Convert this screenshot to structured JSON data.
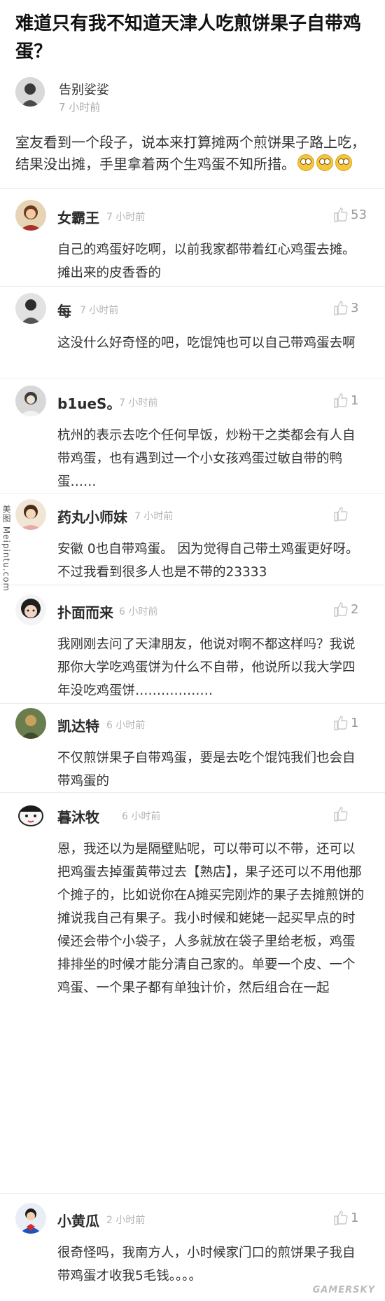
{
  "post": {
    "title": "难道只有我不知道天津人吃煎饼果子自带鸡蛋？",
    "author": {
      "name": "告别娑娑",
      "time": "7 小时前"
    },
    "body": "室友看到一个段子，说本来打算摊两个煎饼果子路上吃，结果没出摊，手里拿着两个生鸡蛋不知所措。",
    "emoji_count": 3
  },
  "comments": [
    {
      "name": "女霸王",
      "time": "7 小时前",
      "likes": "53",
      "text": "自己的鸡蛋好吃啊，以前我家都带着红心鸡蛋去摊。摊出来的皮香香的"
    },
    {
      "name": "每",
      "time": "7 小时前",
      "likes": "3",
      "text": "这没什么好奇怪的吧，吃馄饨也可以自己带鸡蛋去啊"
    },
    {
      "name": "b1ueS。",
      "time": "7 小时前",
      "likes": "1",
      "text": "杭州的表示去吃个任何早饭，炒粉干之类都会有人自带鸡蛋，也有遇到过一个小女孩鸡蛋过敏自带的鸭蛋……"
    },
    {
      "name": "药丸小师妹",
      "time": "7 小时前",
      "likes": "",
      "text": "安徽 0也自带鸡蛋。 因为觉得自己带土鸡蛋更好呀。 不过我看到很多人也是不带的23333"
    },
    {
      "name": "扑面而来",
      "time": "6 小时前",
      "likes": "2",
      "text": "我刚刚去问了天津朋友，他说对啊不都这样吗？我说那你大学吃鸡蛋饼为什么不自带，他说所以我大学四年没吃鸡蛋饼………………"
    },
    {
      "name": "凯达特",
      "time": "6 小时前",
      "likes": "1",
      "text": "不仅煎饼果子自带鸡蛋，要是去吃个馄饨我们也会自带鸡蛋的"
    },
    {
      "name": "暮沐牧",
      "time": "6 小时前",
      "likes": "",
      "text": "恩，我还以为是隔壁贴呢，可以带可以不带，还可以把鸡蛋去掉蛋黄带过去【熟店】，果子还可以不用他那个摊子的，比如说你在A摊买完刚炸的果子去摊煎饼的摊说我自己有果子。我小时候和姥姥一起买早点的时候还会带个小袋子，人多就放在袋子里给老板，鸡蛋排排坐的时候才能分清自己家的。单要一个皮、一个鸡蛋、一个果子都有单独计价，然后组合在一起"
    },
    {
      "name": "小黄瓜",
      "time": "2 小时前",
      "likes": "1",
      "text": "很奇怪吗，我南方人，小时候家门口的煎饼果子我自带鸡蛋才收我5毛钱。。。。"
    }
  ],
  "side_watermark": "美图 Meipintu.com",
  "watermark": "GAMERSKY",
  "colors": {
    "like": "#c8c8c8",
    "time": "#b5b5b5",
    "divider": "#ebebeb"
  }
}
